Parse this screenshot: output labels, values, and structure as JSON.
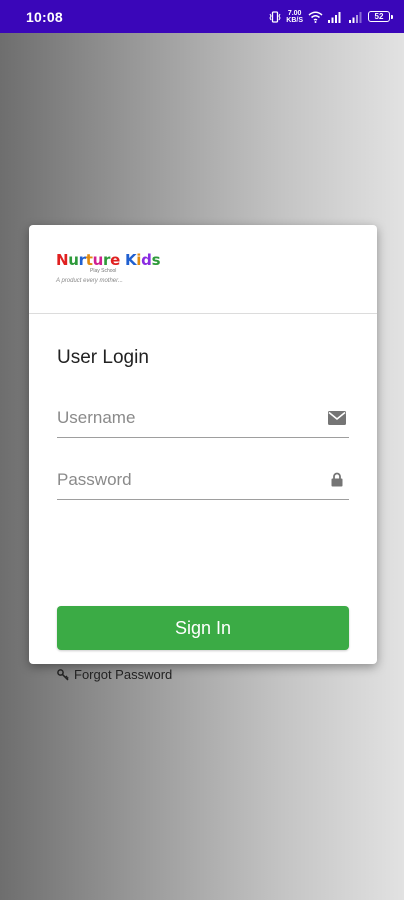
{
  "status_bar": {
    "time": "10:08",
    "net_speed_value": "7.00",
    "net_speed_unit": "KB/S",
    "battery": "52",
    "icons": [
      "vibrate-icon",
      "wifi-icon",
      "signal-icon",
      "signal-icon",
      "battery-icon"
    ],
    "background": "#3a06b9"
  },
  "logo": {
    "brand_letters": [
      {
        "ch": "N",
        "color": "#e02020"
      },
      {
        "ch": "u",
        "color": "#2e9a3a"
      },
      {
        "ch": "r",
        "color": "#2060d0"
      },
      {
        "ch": "t",
        "color": "#e08a10"
      },
      {
        "ch": "u",
        "color": "#d02090"
      },
      {
        "ch": "r",
        "color": "#2e9a3a"
      },
      {
        "ch": "e",
        "color": "#e02020"
      },
      {
        "ch": " ",
        "color": "#000000"
      },
      {
        "ch": "K",
        "color": "#2060d0"
      },
      {
        "ch": "i",
        "color": "#e08a10"
      },
      {
        "ch": "d",
        "color": "#8a2be2"
      },
      {
        "ch": "s",
        "color": "#2e9a3a"
      }
    ],
    "subtitle": "Play School",
    "tagline": "A product every mother..."
  },
  "login": {
    "title": "User Login",
    "username_placeholder": "Username",
    "username_value": "",
    "password_placeholder": "Password",
    "password_value": "",
    "signin_label": "Sign In",
    "forgot_label": "Forgot Password"
  },
  "colors": {
    "primary_button": "#3bab45",
    "field_underline": "#9e9e9e"
  }
}
